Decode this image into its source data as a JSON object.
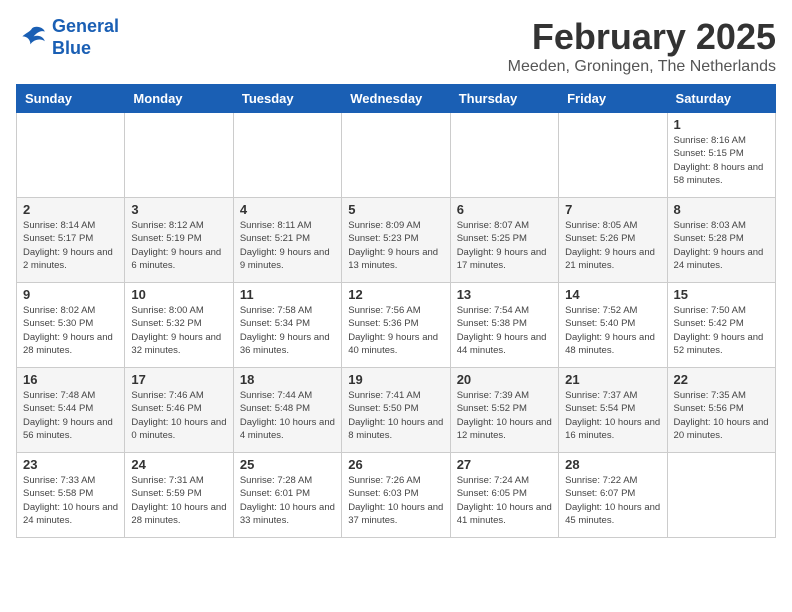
{
  "header": {
    "logo_line1": "General",
    "logo_line2": "Blue",
    "month": "February 2025",
    "location": "Meeden, Groningen, The Netherlands"
  },
  "days_of_week": [
    "Sunday",
    "Monday",
    "Tuesday",
    "Wednesday",
    "Thursday",
    "Friday",
    "Saturday"
  ],
  "weeks": [
    [
      {
        "day": "",
        "info": ""
      },
      {
        "day": "",
        "info": ""
      },
      {
        "day": "",
        "info": ""
      },
      {
        "day": "",
        "info": ""
      },
      {
        "day": "",
        "info": ""
      },
      {
        "day": "",
        "info": ""
      },
      {
        "day": "1",
        "info": "Sunrise: 8:16 AM\nSunset: 5:15 PM\nDaylight: 8 hours and 58 minutes."
      }
    ],
    [
      {
        "day": "2",
        "info": "Sunrise: 8:14 AM\nSunset: 5:17 PM\nDaylight: 9 hours and 2 minutes."
      },
      {
        "day": "3",
        "info": "Sunrise: 8:12 AM\nSunset: 5:19 PM\nDaylight: 9 hours and 6 minutes."
      },
      {
        "day": "4",
        "info": "Sunrise: 8:11 AM\nSunset: 5:21 PM\nDaylight: 9 hours and 9 minutes."
      },
      {
        "day": "5",
        "info": "Sunrise: 8:09 AM\nSunset: 5:23 PM\nDaylight: 9 hours and 13 minutes."
      },
      {
        "day": "6",
        "info": "Sunrise: 8:07 AM\nSunset: 5:25 PM\nDaylight: 9 hours and 17 minutes."
      },
      {
        "day": "7",
        "info": "Sunrise: 8:05 AM\nSunset: 5:26 PM\nDaylight: 9 hours and 21 minutes."
      },
      {
        "day": "8",
        "info": "Sunrise: 8:03 AM\nSunset: 5:28 PM\nDaylight: 9 hours and 24 minutes."
      }
    ],
    [
      {
        "day": "9",
        "info": "Sunrise: 8:02 AM\nSunset: 5:30 PM\nDaylight: 9 hours and 28 minutes."
      },
      {
        "day": "10",
        "info": "Sunrise: 8:00 AM\nSunset: 5:32 PM\nDaylight: 9 hours and 32 minutes."
      },
      {
        "day": "11",
        "info": "Sunrise: 7:58 AM\nSunset: 5:34 PM\nDaylight: 9 hours and 36 minutes."
      },
      {
        "day": "12",
        "info": "Sunrise: 7:56 AM\nSunset: 5:36 PM\nDaylight: 9 hours and 40 minutes."
      },
      {
        "day": "13",
        "info": "Sunrise: 7:54 AM\nSunset: 5:38 PM\nDaylight: 9 hours and 44 minutes."
      },
      {
        "day": "14",
        "info": "Sunrise: 7:52 AM\nSunset: 5:40 PM\nDaylight: 9 hours and 48 minutes."
      },
      {
        "day": "15",
        "info": "Sunrise: 7:50 AM\nSunset: 5:42 PM\nDaylight: 9 hours and 52 minutes."
      }
    ],
    [
      {
        "day": "16",
        "info": "Sunrise: 7:48 AM\nSunset: 5:44 PM\nDaylight: 9 hours and 56 minutes."
      },
      {
        "day": "17",
        "info": "Sunrise: 7:46 AM\nSunset: 5:46 PM\nDaylight: 10 hours and 0 minutes."
      },
      {
        "day": "18",
        "info": "Sunrise: 7:44 AM\nSunset: 5:48 PM\nDaylight: 10 hours and 4 minutes."
      },
      {
        "day": "19",
        "info": "Sunrise: 7:41 AM\nSunset: 5:50 PM\nDaylight: 10 hours and 8 minutes."
      },
      {
        "day": "20",
        "info": "Sunrise: 7:39 AM\nSunset: 5:52 PM\nDaylight: 10 hours and 12 minutes."
      },
      {
        "day": "21",
        "info": "Sunrise: 7:37 AM\nSunset: 5:54 PM\nDaylight: 10 hours and 16 minutes."
      },
      {
        "day": "22",
        "info": "Sunrise: 7:35 AM\nSunset: 5:56 PM\nDaylight: 10 hours and 20 minutes."
      }
    ],
    [
      {
        "day": "23",
        "info": "Sunrise: 7:33 AM\nSunset: 5:58 PM\nDaylight: 10 hours and 24 minutes."
      },
      {
        "day": "24",
        "info": "Sunrise: 7:31 AM\nSunset: 5:59 PM\nDaylight: 10 hours and 28 minutes."
      },
      {
        "day": "25",
        "info": "Sunrise: 7:28 AM\nSunset: 6:01 PM\nDaylight: 10 hours and 33 minutes."
      },
      {
        "day": "26",
        "info": "Sunrise: 7:26 AM\nSunset: 6:03 PM\nDaylight: 10 hours and 37 minutes."
      },
      {
        "day": "27",
        "info": "Sunrise: 7:24 AM\nSunset: 6:05 PM\nDaylight: 10 hours and 41 minutes."
      },
      {
        "day": "28",
        "info": "Sunrise: 7:22 AM\nSunset: 6:07 PM\nDaylight: 10 hours and 45 minutes."
      },
      {
        "day": "",
        "info": ""
      }
    ]
  ]
}
